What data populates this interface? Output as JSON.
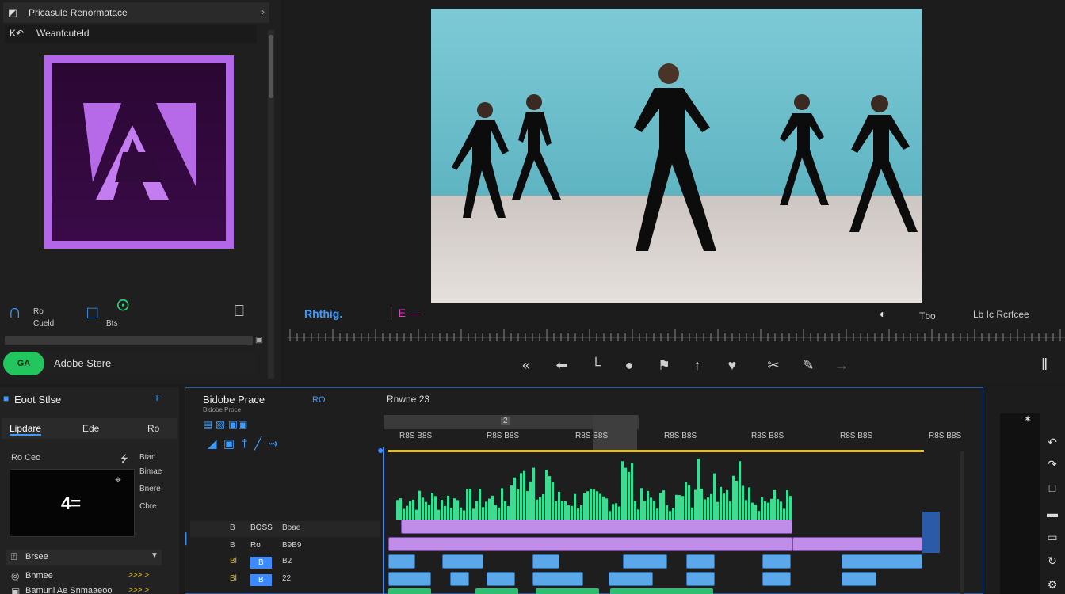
{
  "left_panel": {
    "header_title": "Pricasule Renormatace",
    "sub_title": "Weanfcuteld",
    "icon_labels": [
      "Ro",
      "Cueld",
      "Bts"
    ],
    "bottom_label": "Adobe Stere",
    "ga_label": "GA"
  },
  "monitor": {
    "timecode_label": "Rhthig.",
    "right_label_1": "Tbo",
    "right_label_2": "Lb Ic Rcrfcee",
    "transport_icons": [
      "step-back-icon",
      "rewind-icon",
      "mark-in-icon",
      "record-icon",
      "flag-icon",
      "up-arrow-icon",
      "heart-icon",
      "cut-icon",
      "pen-icon",
      "forward-icon",
      "pause-icon"
    ]
  },
  "bottom_left": {
    "title": "Eoot Stlse",
    "tabs": [
      "Lipdare",
      "Ede",
      "Ro"
    ],
    "row_labels": [
      "Ro Ceo",
      "Btan",
      "Bimae",
      "Bnere",
      "Cbre"
    ],
    "preview_text": "4=",
    "dropdown_label": "Brsee",
    "list_items": [
      "Bnmee",
      "Bamunl Ae Snmaaeoo"
    ],
    "list_arrows": ">>> >"
  },
  "timeline": {
    "title": "Bidobe Prace",
    "subtitle": "Bidobe Proce",
    "current_label": "Rnwne 23",
    "tool_label": "RO",
    "time_markers": [
      "R8S B8S",
      "R8S B8S",
      "R8S B8S",
      "R8S B8S",
      "R8S B8S",
      "R8S B8S",
      "R8S B8S"
    ],
    "tracks": [
      {
        "a": "B",
        "b": "BOSS",
        "c": "Boae"
      },
      {
        "a": "B",
        "b": "Ro",
        "c": "B9B9"
      },
      {
        "a": "Bl",
        "b": "B",
        "c": "B2"
      },
      {
        "a": "Bl",
        "b": "B",
        "c": "22"
      }
    ]
  },
  "colors": {
    "accent_blue": "#3b8bff",
    "clip_purple": "#c08ee8",
    "clip_blue": "#5aa8ea",
    "audio_green": "#2ee29a",
    "logo_purple": "#b466e8",
    "ga_green": "#22c55e"
  }
}
